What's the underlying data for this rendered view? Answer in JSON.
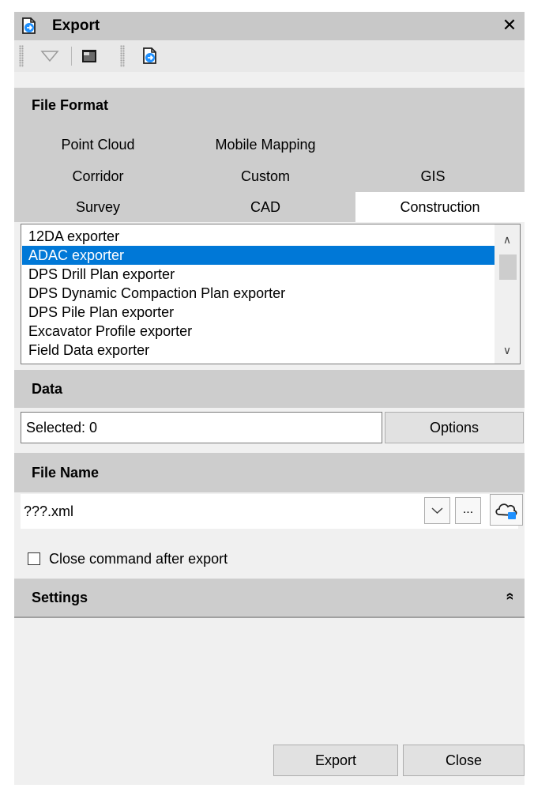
{
  "window": {
    "title": "Export",
    "close_glyph": "✕",
    "title_icon": "export-icon"
  },
  "toolbar": {
    "icons": [
      "filter-icon",
      "console-icon",
      "export-icon"
    ]
  },
  "file_format": {
    "heading": "File Format",
    "tabs": {
      "row1": [
        "Point Cloud",
        "Mobile Mapping"
      ],
      "row2": [
        "Corridor",
        "Custom",
        "GIS"
      ],
      "row3": [
        "Survey",
        "CAD",
        "Construction"
      ]
    },
    "active_tab": "Construction",
    "items": [
      "12DA exporter",
      "ADAC exporter",
      "DPS Drill Plan exporter",
      "DPS Dynamic Compaction Plan exporter",
      "DPS Pile Plan exporter",
      "Excavator Profile exporter",
      "Field Data exporter"
    ],
    "selected_item": "ADAC exporter"
  },
  "data": {
    "heading": "Data",
    "selected_text": "Selected: 0",
    "options_label": "Options"
  },
  "file_name": {
    "heading": "File Name",
    "value": "???.xml",
    "browse_label": "..."
  },
  "close_after_export": {
    "label": "Close command after export",
    "checked": false
  },
  "settings": {
    "heading": "Settings",
    "collapse_glyph": "»"
  },
  "footer": {
    "export_label": "Export",
    "close_label": "Close"
  },
  "colors": {
    "selection": "#0078d7",
    "section_header": "#cdcdcd",
    "panel": "#f0f0f0"
  }
}
